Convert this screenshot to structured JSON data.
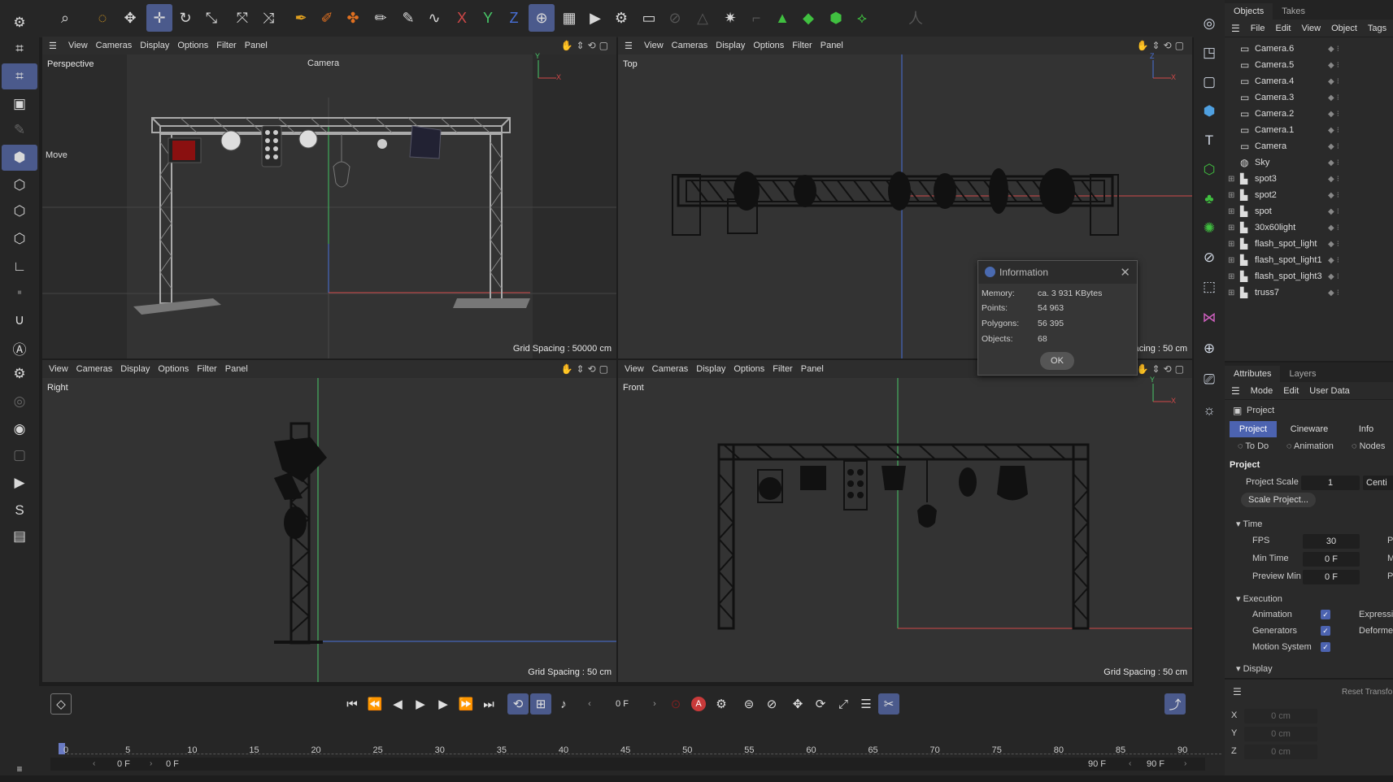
{
  "viewport_menu": {
    "view": "View",
    "cameras": "Cameras",
    "display": "Display",
    "options": "Options",
    "filter": "Filter",
    "panel": "Panel"
  },
  "viewports": {
    "perspective": {
      "label": "Perspective",
      "camera": "Camera",
      "move": "Move",
      "grid": "Grid Spacing : 50000 cm"
    },
    "top": {
      "label": "Top",
      "grid": "Grid Spacing : 50 cm"
    },
    "right": {
      "label": "Right",
      "grid": "Grid Spacing : 50 cm"
    },
    "front": {
      "label": "Front",
      "grid": "Grid Spacing : 50 cm"
    }
  },
  "axis_labels": {
    "x": "X",
    "y": "Y",
    "z": "Z"
  },
  "toolbar_letters": {
    "x": "X",
    "y": "Y",
    "z": "Z"
  },
  "dialog": {
    "title": "Information",
    "rows": [
      {
        "label": "Memory:",
        "value": "ca. 3 931 KBytes"
      },
      {
        "label": "Points:",
        "value": "54 963"
      },
      {
        "label": "Polygons:",
        "value": "56 395"
      },
      {
        "label": "Objects:",
        "value": "68"
      }
    ],
    "ok": "OK"
  },
  "objects_panel": {
    "tabs": [
      "Objects",
      "Takes"
    ],
    "menu": [
      "File",
      "Edit",
      "View",
      "Object",
      "Tags"
    ],
    "items": [
      {
        "name": "Camera.6",
        "icon": "camera-icon"
      },
      {
        "name": "Camera.5",
        "icon": "camera-icon"
      },
      {
        "name": "Camera.4",
        "icon": "camera-icon"
      },
      {
        "name": "Camera.3",
        "icon": "camera-icon"
      },
      {
        "name": "Camera.2",
        "icon": "camera-icon"
      },
      {
        "name": "Camera.1",
        "icon": "camera-icon"
      },
      {
        "name": "Camera",
        "icon": "camera-icon"
      },
      {
        "name": "Sky",
        "icon": "sky-icon"
      },
      {
        "name": "spot3",
        "icon": "null-icon"
      },
      {
        "name": "spot2",
        "icon": "null-icon"
      },
      {
        "name": "spot",
        "icon": "null-icon"
      },
      {
        "name": "30x60light",
        "icon": "null-icon"
      },
      {
        "name": "flash_spot_light",
        "icon": "null-icon"
      },
      {
        "name": "flash_spot_light1",
        "icon": "null-icon"
      },
      {
        "name": "flash_spot_light3",
        "icon": "null-icon"
      },
      {
        "name": "truss7",
        "icon": "null-icon"
      }
    ]
  },
  "attributes": {
    "tabs": [
      "Attributes",
      "Layers"
    ],
    "menu": [
      "Mode",
      "Edit",
      "User Data"
    ],
    "object": "Project",
    "ptabs": [
      "Project",
      "Cineware",
      "Info"
    ],
    "subtabs": [
      "To Do",
      "Animation",
      "Nodes"
    ],
    "section": "Project",
    "project_scale_label": "Project Scale",
    "project_scale_value": "1",
    "project_scale_unit": "Centi",
    "scale_button": "Scale Project...",
    "time_header": "Time",
    "fps_label": "FPS",
    "fps_value": "30",
    "min_time_label": "Min Time",
    "min_time_value": "0 F",
    "preview_min_label": "Preview Min",
    "preview_min_value": "0 F",
    "right_trunc": [
      "P",
      "M",
      "P"
    ],
    "execution_header": "Execution",
    "animation_label": "Animation",
    "generators_label": "Generators",
    "motion_label": "Motion System",
    "expressions_label": "Expressi",
    "deformers_label": "Deforme",
    "display_header": "Display"
  },
  "coords": {
    "reset": "Reset Transfo",
    "rows": [
      {
        "axis": "X",
        "value": "0 cm"
      },
      {
        "axis": "Y",
        "value": "0 cm"
      },
      {
        "axis": "Z",
        "value": "0 cm"
      }
    ]
  },
  "timeline": {
    "current_frame": "0 F",
    "ticks": [
      "0",
      "5",
      "10",
      "15",
      "20",
      "25",
      "30",
      "35",
      "40",
      "45",
      "50",
      "55",
      "60",
      "65",
      "70",
      "75",
      "80",
      "85",
      "90"
    ],
    "start_frame": "0 F",
    "range_start": "0 F",
    "range_end": "90 F",
    "end_frame": "90 F"
  },
  "colors": {
    "accent": "#4b5a8c",
    "x_axis": "#d04848",
    "y_axis": "#48c868",
    "z_axis": "#4870d8"
  }
}
